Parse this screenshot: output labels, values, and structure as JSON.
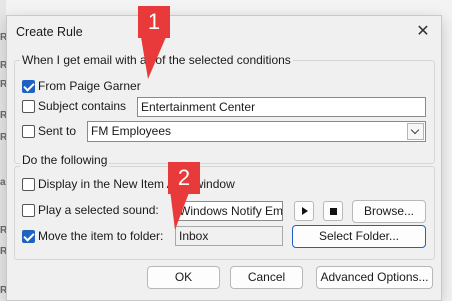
{
  "edge_letters": [
    "R",
    "R",
    "R",
    "R",
    "R",
    "a",
    "R",
    "R",
    "R"
  ],
  "dialog": {
    "title": "Create Rule",
    "conditions": {
      "legend": "When I get email with all of the selected conditions",
      "from": {
        "label": "From Paige Garner",
        "checked": true
      },
      "subject": {
        "label": "Subject contains",
        "checked": false,
        "value": "Entertainment Center"
      },
      "sent_to": {
        "label": "Sent to",
        "checked": false,
        "selected": "FM Employees"
      }
    },
    "actions": {
      "legend": "Do the following",
      "display": {
        "label": "Display in the New Item Alert window",
        "checked": false
      },
      "play_sound": {
        "label": "Play a selected sound:",
        "checked": false,
        "value": "Windows Notify Em",
        "browse_label": "Browse..."
      },
      "move": {
        "label": "Move the item to folder:",
        "checked": true,
        "value": "Inbox",
        "select_folder_label": "Select Folder..."
      }
    },
    "buttons": {
      "ok": "OK",
      "cancel": "Cancel",
      "advanced": "Advanced Options..."
    }
  },
  "callouts": [
    {
      "label": "1",
      "color": "#e83a3a"
    },
    {
      "label": "2",
      "color": "#e83a3a"
    }
  ]
}
